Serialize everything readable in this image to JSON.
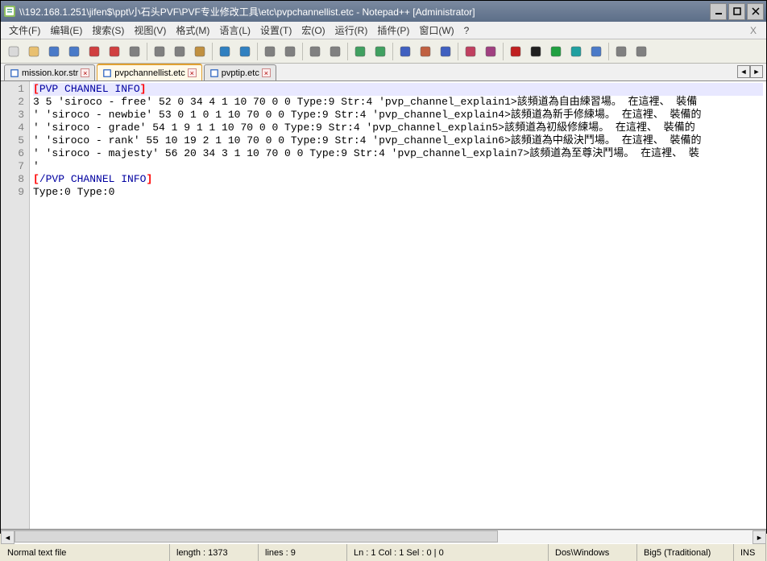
{
  "window": {
    "title": "\\\\192.168.1.251\\jifen$\\ppt\\小石头PVF\\PVF专业修改工具\\etc\\pvpchannellist.etc - Notepad++ [Administrator]"
  },
  "menu": {
    "items": [
      "文件(F)",
      "编辑(E)",
      "搜索(S)",
      "视图(V)",
      "格式(M)",
      "语言(L)",
      "设置(T)",
      "宏(O)",
      "运行(R)",
      "插件(P)",
      "窗口(W)",
      "?"
    ]
  },
  "toolbar": {
    "buttons": [
      {
        "name": "new-file-icon",
        "color": "#d9d9d9"
      },
      {
        "name": "open-file-icon",
        "color": "#e8c070"
      },
      {
        "name": "save-icon",
        "color": "#4a7ac8"
      },
      {
        "name": "save-all-icon",
        "color": "#4a7ac8"
      },
      {
        "name": "close-icon",
        "color": "#d04040"
      },
      {
        "name": "close-all-icon",
        "color": "#d04040"
      },
      {
        "name": "print-icon",
        "color": "#808080"
      },
      {
        "sep": true
      },
      {
        "name": "cut-icon",
        "color": "#808080"
      },
      {
        "name": "copy-icon",
        "color": "#808080"
      },
      {
        "name": "paste-icon",
        "color": "#c09040"
      },
      {
        "sep": true
      },
      {
        "name": "undo-icon",
        "color": "#3080c0"
      },
      {
        "name": "redo-icon",
        "color": "#3080c0"
      },
      {
        "sep": true
      },
      {
        "name": "find-icon",
        "color": "#808080"
      },
      {
        "name": "replace-icon",
        "color": "#808080"
      },
      {
        "sep": true
      },
      {
        "name": "zoom-in-icon",
        "color": "#808080"
      },
      {
        "name": "zoom-out-icon",
        "color": "#808080"
      },
      {
        "sep": true
      },
      {
        "name": "sync-v-icon",
        "color": "#40a060"
      },
      {
        "name": "sync-h-icon",
        "color": "#40a060"
      },
      {
        "sep": true
      },
      {
        "name": "wordwrap-icon",
        "color": "#4060c0"
      },
      {
        "name": "show-all-chars-icon",
        "color": "#c06040"
      },
      {
        "name": "indent-guide-icon",
        "color": "#4060c0"
      },
      {
        "sep": true
      },
      {
        "name": "lang-panel-icon",
        "color": "#c04060"
      },
      {
        "name": "doc-map-icon",
        "color": "#a04080"
      },
      {
        "sep": true
      },
      {
        "name": "macro-record-icon",
        "color": "#c02020"
      },
      {
        "name": "macro-stop-icon",
        "color": "#202020"
      },
      {
        "name": "macro-play-icon",
        "color": "#20a040"
      },
      {
        "name": "macro-play-multi-icon",
        "color": "#20a0a0"
      },
      {
        "name": "macro-save-icon",
        "color": "#4a7ac8"
      },
      {
        "sep": true
      },
      {
        "name": "plugin1-icon",
        "color": "#808080"
      },
      {
        "name": "plugin2-icon",
        "color": "#808080"
      }
    ]
  },
  "tabs": [
    {
      "label": "mission.kor.str",
      "active": false,
      "close": true
    },
    {
      "label": "pvpchannellist.etc",
      "active": true,
      "close": true
    },
    {
      "label": "pvptip.etc",
      "active": false,
      "close": true
    }
  ],
  "editor": {
    "lines": [
      {
        "n": 1,
        "raw": "[PVP CHANNEL INFO]",
        "style": "tag"
      },
      {
        "n": 2,
        "raw": "3 5 'siroco - free' 52 0 34 4 1 10 70 0 0 Type:9 Str:4 'pvp_channel_explain1>該頻道為自由練習場。 在這裡、 裝備"
      },
      {
        "n": 3,
        "raw": "' 'siroco - newbie' 53 0 1 0 1 10 70 0 0 Type:9 Str:4 'pvp_channel_explain4>該頻道為新手修練場。 在這裡、 裝備的"
      },
      {
        "n": 4,
        "raw": "' 'siroco - grade' 54 1 9 1 1 10 70 0 0 Type:9 Str:4 'pvp_channel_explain5>該頻道為初級修練場。 在這裡、 裝備的"
      },
      {
        "n": 5,
        "raw": "' 'siroco - rank' 55 10 19 2 1 10 70 0 0 Type:9 Str:4 'pvp_channel_explain6>該頻道為中級決鬥場。 在這裡、 裝備的"
      },
      {
        "n": 6,
        "raw": "' 'siroco - majesty' 56 20 34 3 1 10 70 0 0 Type:9 Str:4 'pvp_channel_explain7>該頻道為至尊決鬥場。 在這裡、 裝"
      },
      {
        "n": 7,
        "raw": "'"
      },
      {
        "n": 8,
        "raw": "[/PVP CHANNEL INFO]",
        "style": "tag"
      },
      {
        "n": 9,
        "raw": "Type:0 Type:0"
      }
    ]
  },
  "status": {
    "filetype": "Normal text file",
    "length_label": "length : 1373",
    "lines_label": "lines : 9",
    "pos_label": "Ln : 1   Col : 1   Sel : 0 | 0",
    "eol": "Dos\\Windows",
    "encoding": "Big5 (Traditional)",
    "ins": "INS"
  }
}
